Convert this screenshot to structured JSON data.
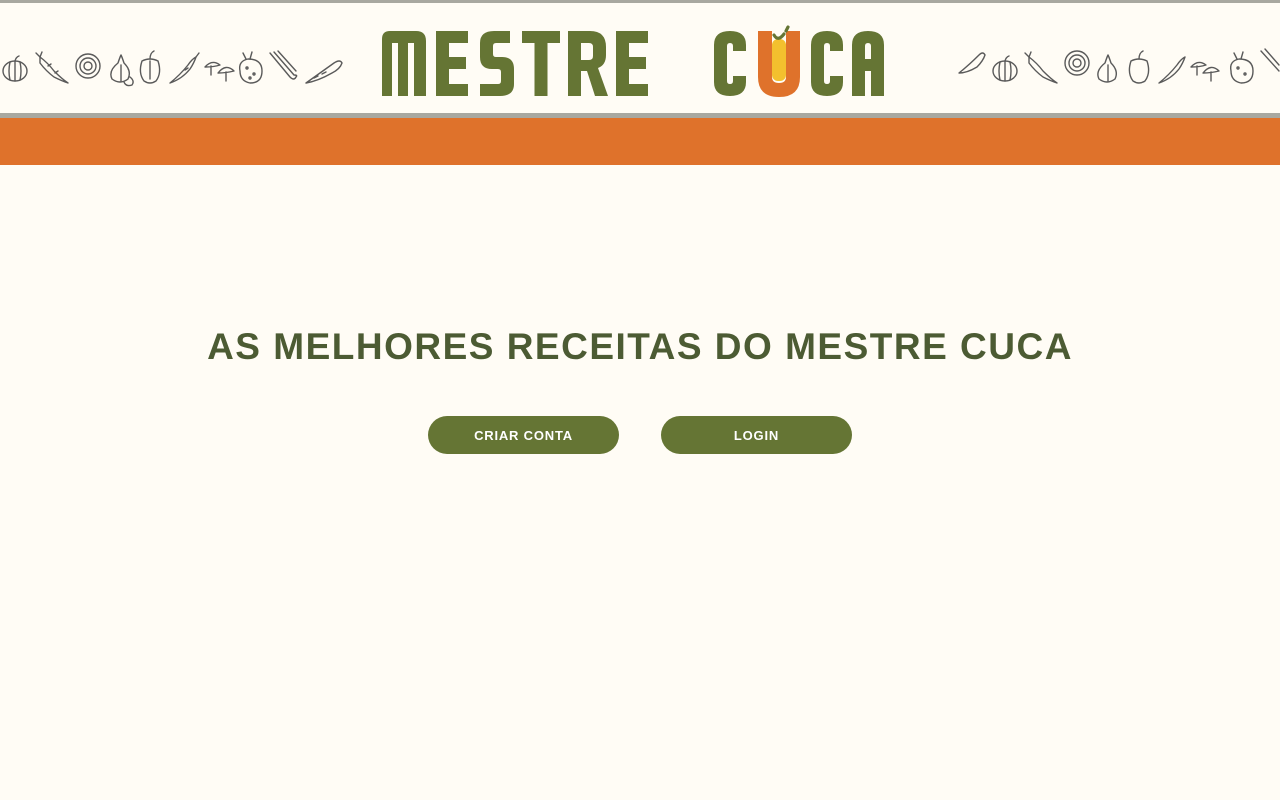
{
  "brand": {
    "name": "MESTRE CUCA",
    "word1": "MESTRE",
    "word2_c": "C",
    "word2_rest": "CA"
  },
  "colors": {
    "brand_green": "#657534",
    "title_green": "#4C5B33",
    "orange": "#DF722B",
    "yellow": "#F3C02E",
    "cream_background": "#FFFCF5",
    "rule_gray": "#A8A8A0"
  },
  "header": {
    "left_decoration": "vegetables-doodle-strip",
    "right_decoration": "vegetables-doodle-strip"
  },
  "hero": {
    "title": "AS MELHORES RECEITAS DO MESTRE CUCA"
  },
  "actions": {
    "create_account_label": "CRIAR CONTA",
    "login_label": "LOGIN"
  }
}
